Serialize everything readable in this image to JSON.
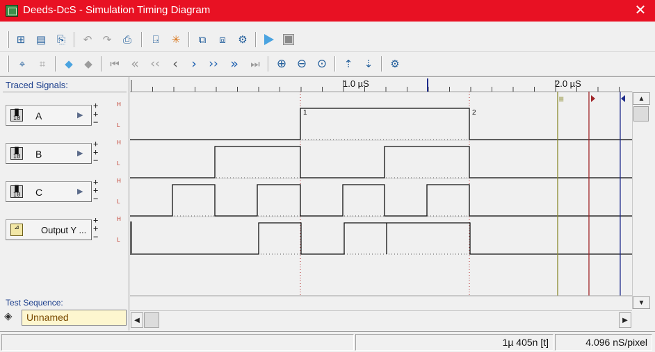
{
  "window": {
    "title": "Deeds-DcS  -  Simulation Timing Diagram",
    "close_glyph": "✕"
  },
  "toolbar1": [
    {
      "name": "network-export-icon",
      "glyph": "⊞"
    },
    {
      "name": "document-icon",
      "glyph": "▤"
    },
    {
      "name": "document-arrow-icon",
      "glyph": "⎘"
    },
    {
      "name": "undo-icon",
      "glyph": "↶"
    },
    {
      "name": "redo-icon",
      "glyph": "↷"
    },
    {
      "name": "print-icon",
      "glyph": "⎙"
    },
    {
      "name": "add-signal-icon",
      "glyph": "⍈"
    },
    {
      "name": "remove-signal-icon",
      "glyph": "✳"
    },
    {
      "name": "split-icon",
      "glyph": "⧉"
    },
    {
      "name": "merge-icon",
      "glyph": "⧈"
    },
    {
      "name": "cursor-settings-icon",
      "glyph": "⚙"
    },
    {
      "name": "play-icon",
      "glyph": "▶"
    },
    {
      "name": "stop-icon",
      "glyph": "■"
    }
  ],
  "toolbar2": [
    {
      "name": "cursor-tool-icon",
      "glyph": "⌖"
    },
    {
      "name": "cursor-tool-disabled-icon",
      "glyph": "⌗"
    },
    {
      "name": "arrow-left-icon",
      "glyph": "◆"
    },
    {
      "name": "arrow-right-icon",
      "glyph": "◆"
    },
    {
      "name": "go-start-icon",
      "glyph": "⏮"
    },
    {
      "name": "fast-rewind-icon",
      "glyph": "«"
    },
    {
      "name": "rewind-icon",
      "glyph": "‹‹"
    },
    {
      "name": "step-back-icon",
      "glyph": "‹"
    },
    {
      "name": "step-forward-icon",
      "glyph": "›"
    },
    {
      "name": "forward-icon",
      "glyph": "››"
    },
    {
      "name": "fast-forward-icon",
      "glyph": "»"
    },
    {
      "name": "go-end-icon",
      "glyph": "⏭"
    },
    {
      "name": "zoom-in-icon",
      "glyph": "⊕"
    },
    {
      "name": "zoom-out-icon",
      "glyph": "⊖"
    },
    {
      "name": "zoom-fit-icon",
      "glyph": "⊙"
    },
    {
      "name": "move-up-icon",
      "glyph": "⇡"
    },
    {
      "name": "move-down-icon",
      "glyph": "⇣"
    },
    {
      "name": "settings-icon",
      "glyph": "⚙"
    }
  ],
  "signals_panel": {
    "label": "Traced Signals:",
    "signals": [
      {
        "name": "A",
        "kind": "input"
      },
      {
        "name": "B",
        "kind": "input"
      },
      {
        "name": "C",
        "kind": "input"
      },
      {
        "name": "Output Y ...",
        "kind": "output"
      }
    ],
    "level_high": "H",
    "level_low": "L"
  },
  "test_sequence": {
    "label": "Test Sequence:",
    "value": "Unnamed"
  },
  "ruler": {
    "labels": [
      "1.0 µS",
      "2.0 µS"
    ]
  },
  "markers": {
    "cursor1_label": "1",
    "cursor2_label": "2"
  },
  "status": {
    "left": "",
    "time": "1µ 405n  [t]",
    "scale": "4.096 nS/pixel"
  },
  "colors": {
    "titlebar": "#e81123",
    "marker_olive": "#8b8b2e",
    "marker_red": "#a0262a",
    "marker_blue": "#1e2b8a"
  }
}
